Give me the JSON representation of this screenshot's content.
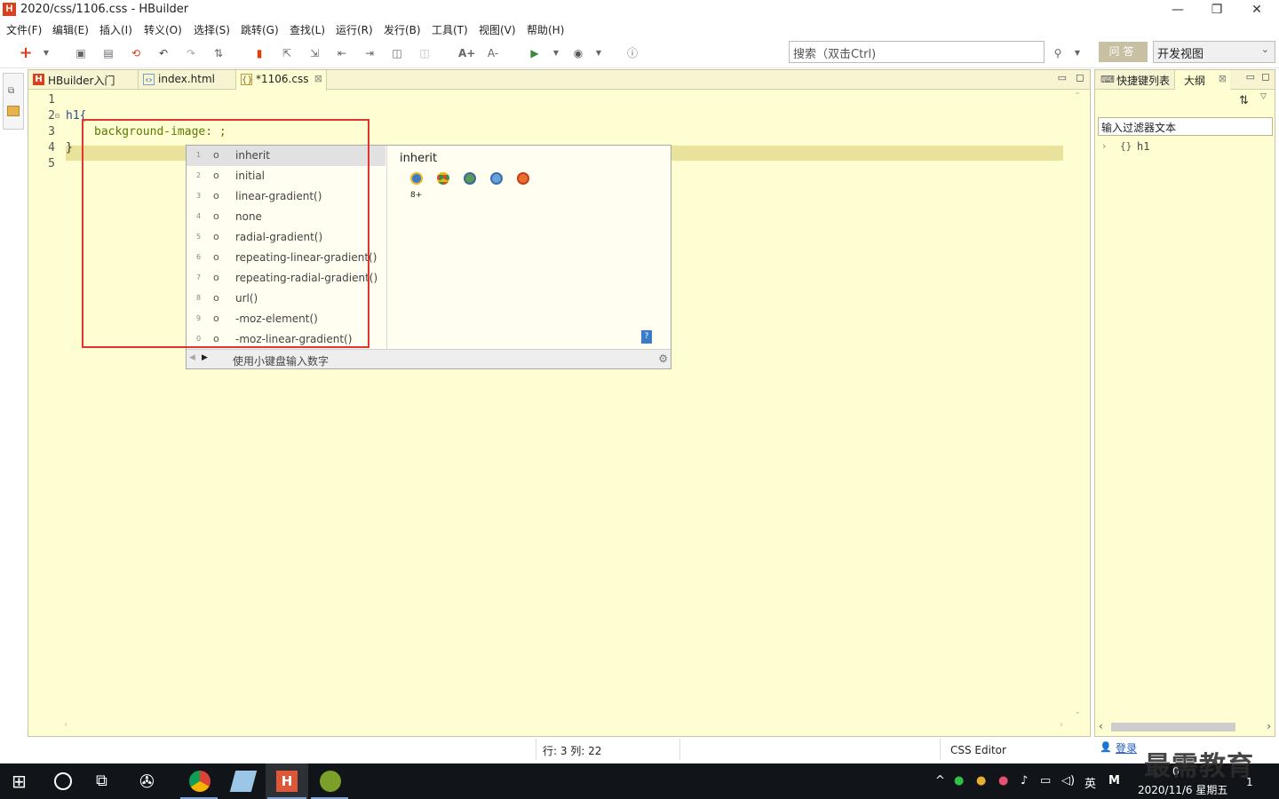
{
  "window": {
    "title": "2020/css/1106.css  -  HBuilder",
    "app_icon": "H",
    "minimize": "—",
    "restore": "❐",
    "close": "✕"
  },
  "menu": [
    "文件(F)",
    "编辑(E)",
    "插入(I)",
    "转义(O)",
    "选择(S)",
    "跳转(G)",
    "查找(L)",
    "运行(R)",
    "发行(B)",
    "工具(T)",
    "视图(V)",
    "帮助(H)"
  ],
  "toolbar": {
    "search_placeholder": "搜索（双击Ctrl)",
    "qa_label": "问答",
    "view_select": "开发视图",
    "font_up": "A+",
    "font_down": "A-"
  },
  "tabs": [
    {
      "label": "HBuilder入门",
      "icon": "hbuilder-icon"
    },
    {
      "label": "index.html",
      "icon": "html-file-icon"
    },
    {
      "label": "*1106.css",
      "icon": "css-file-icon",
      "active": true,
      "close": "⊠"
    }
  ],
  "editor": {
    "line_numbers": [
      "1",
      "2",
      "3",
      "4",
      "5"
    ],
    "lines": [
      "",
      "h1{",
      "background-image:  ;",
      "}",
      ""
    ],
    "current_line": 3
  },
  "autocomplete": {
    "items": [
      {
        "n": "1",
        "label": "inherit"
      },
      {
        "n": "2",
        "label": "initial"
      },
      {
        "n": "3",
        "label": "linear-gradient()"
      },
      {
        "n": "4",
        "label": "none"
      },
      {
        "n": "5",
        "label": "radial-gradient()"
      },
      {
        "n": "6",
        "label": "repeating-linear-gradient()"
      },
      {
        "n": "7",
        "label": "repeating-radial-gradient()"
      },
      {
        "n": "8",
        "label": "url()"
      },
      {
        "n": "9",
        "label": "-moz-element()"
      },
      {
        "n": "0",
        "label": "-moz-linear-gradient()"
      }
    ],
    "doc_title": "inherit",
    "browser_version": "8+",
    "footer_hint": "使用小键盘输入数字",
    "browsers": [
      "ie-icon",
      "chrome-icon",
      "android-icon",
      "safari-icon",
      "firefox-icon"
    ]
  },
  "right_panel": {
    "tab_shortcuts": "快捷键列表",
    "tab_outline": "大纲",
    "filter_placeholder": "输入过滤器文本",
    "outline_items": [
      {
        "icon": "{}",
        "label": "h1"
      }
    ]
  },
  "status": {
    "position": "行: 3 列: 22",
    "editor_type": "CSS Editor",
    "login": "登录"
  },
  "taskbar": {
    "ime": "英",
    "ime2": "M",
    "date": "2020/11/6 星期五",
    "time": "0",
    "notif": "1"
  },
  "watermark": "最需教育",
  "colors": {
    "editor_bg": "#fffed2",
    "current_line": "#e9e29a",
    "keyword": "#5a7a00",
    "red_box": "#e3342f",
    "taskbar": "#111419"
  }
}
